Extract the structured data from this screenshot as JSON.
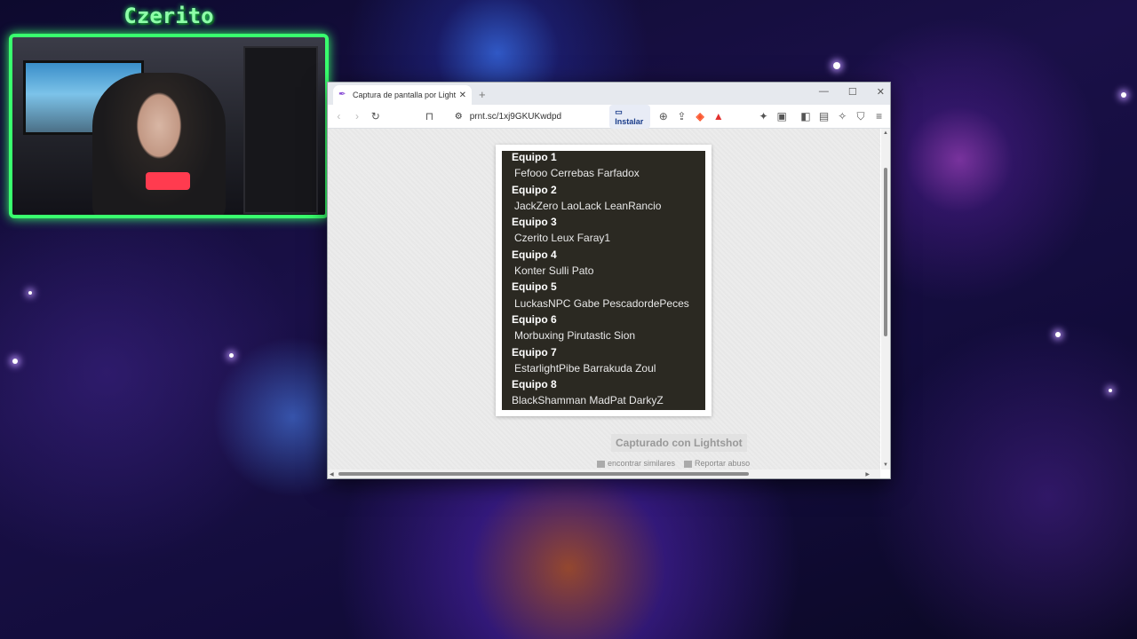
{
  "overlay": {
    "streamer_name": "Czerito"
  },
  "browser": {
    "tab_title": "Captura de pantalla por Lightshot",
    "tab_close": "✕",
    "new_tab": "+",
    "window_controls": {
      "minimize": "—",
      "maximize": "☐",
      "close": "✕"
    },
    "url": "prnt.sc/1xj9GKUKwdpd",
    "install_label": "Instalar"
  },
  "screenshot_content": {
    "teams": [
      {
        "name": "Equipo 1",
        "members": "Fefooo Cerrebas Farfadox"
      },
      {
        "name": "Equipo 2",
        "members": "JackZero LaoLack LeanRancio"
      },
      {
        "name": "Equipo 3",
        "members": "Czerito Leux Faray1"
      },
      {
        "name": "Equipo 4",
        "members": "Konter Sulli Pato"
      },
      {
        "name": "Equipo 5",
        "members": "LuckasNPC Gabe PescadordePeces"
      },
      {
        "name": "Equipo 6",
        "members": "Morbuxing Pirutastic Sion"
      },
      {
        "name": "Equipo 7",
        "members": "EstarlightPibe Barrakuda Zoul"
      },
      {
        "name": "Equipo 8",
        "members": "BlackShamman MadPat DarkyZ"
      }
    ]
  },
  "lightshot": {
    "captured_label": "Capturado con Lightshot",
    "find_similar": "encontrar similares",
    "report_abuse": "Reportar abuso"
  }
}
